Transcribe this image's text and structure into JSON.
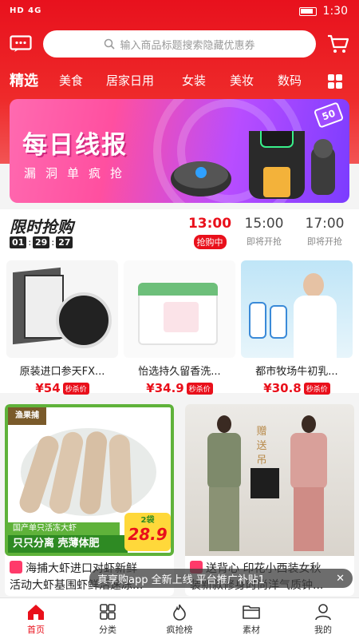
{
  "status": {
    "carrier": "HD 4G",
    "time": "1:30"
  },
  "search": {
    "placeholder": "输入商品标题搜索隐藏优惠券"
  },
  "categories": [
    "精选",
    "美食",
    "居家日用",
    "女装",
    "美妆",
    "数码"
  ],
  "banner": {
    "title": "每日线报",
    "subtitle": "漏洞单疯抢",
    "badge": "50"
  },
  "flash_sale": {
    "title": "限时抢购",
    "countdown": [
      "01",
      "29",
      "27"
    ],
    "slots": [
      {
        "time": "13:00",
        "status": "抢购中"
      },
      {
        "time": "15:00",
        "status": "即将开抢"
      },
      {
        "time": "17:00",
        "status": "即将开抢"
      }
    ],
    "products": [
      {
        "name": "原装进口参天FX...",
        "price": "¥54",
        "tag": "秒杀价"
      },
      {
        "name": "怡选持久留香洗...",
        "price": "¥34.9",
        "tag": "秒杀价"
      },
      {
        "name": "都市牧场牛初乳...",
        "price": "¥30.8",
        "tag": "秒杀价"
      }
    ]
  },
  "feed": [
    {
      "line1": "海捕大虾进口对虾新鲜",
      "line2": "活动大虾基围虾鲜活速冻...",
      "img_text": {
        "brand": "渔果捕",
        "promo1": "国产单只活冻大虾",
        "promo2": "只只分离 壳薄体肥",
        "qty": "2袋",
        "price": "28.9"
      }
    },
    {
      "line1": "送背心 印花小西装女秋",
      "line2": "装新款修身时尚洋气质钟...",
      "img_text": {
        "gift": "赠送吊带"
      }
    }
  ],
  "toast": {
    "text": "真享购app 全新上线 平台推广补贴1",
    "close": "✕"
  },
  "tabs": [
    "首页",
    "分类",
    "疯抢榜",
    "素材",
    "我的"
  ],
  "colors": {
    "brand": "#e9101b",
    "banner_start": "#ff6ab0",
    "banner_end": "#7b3cff"
  }
}
